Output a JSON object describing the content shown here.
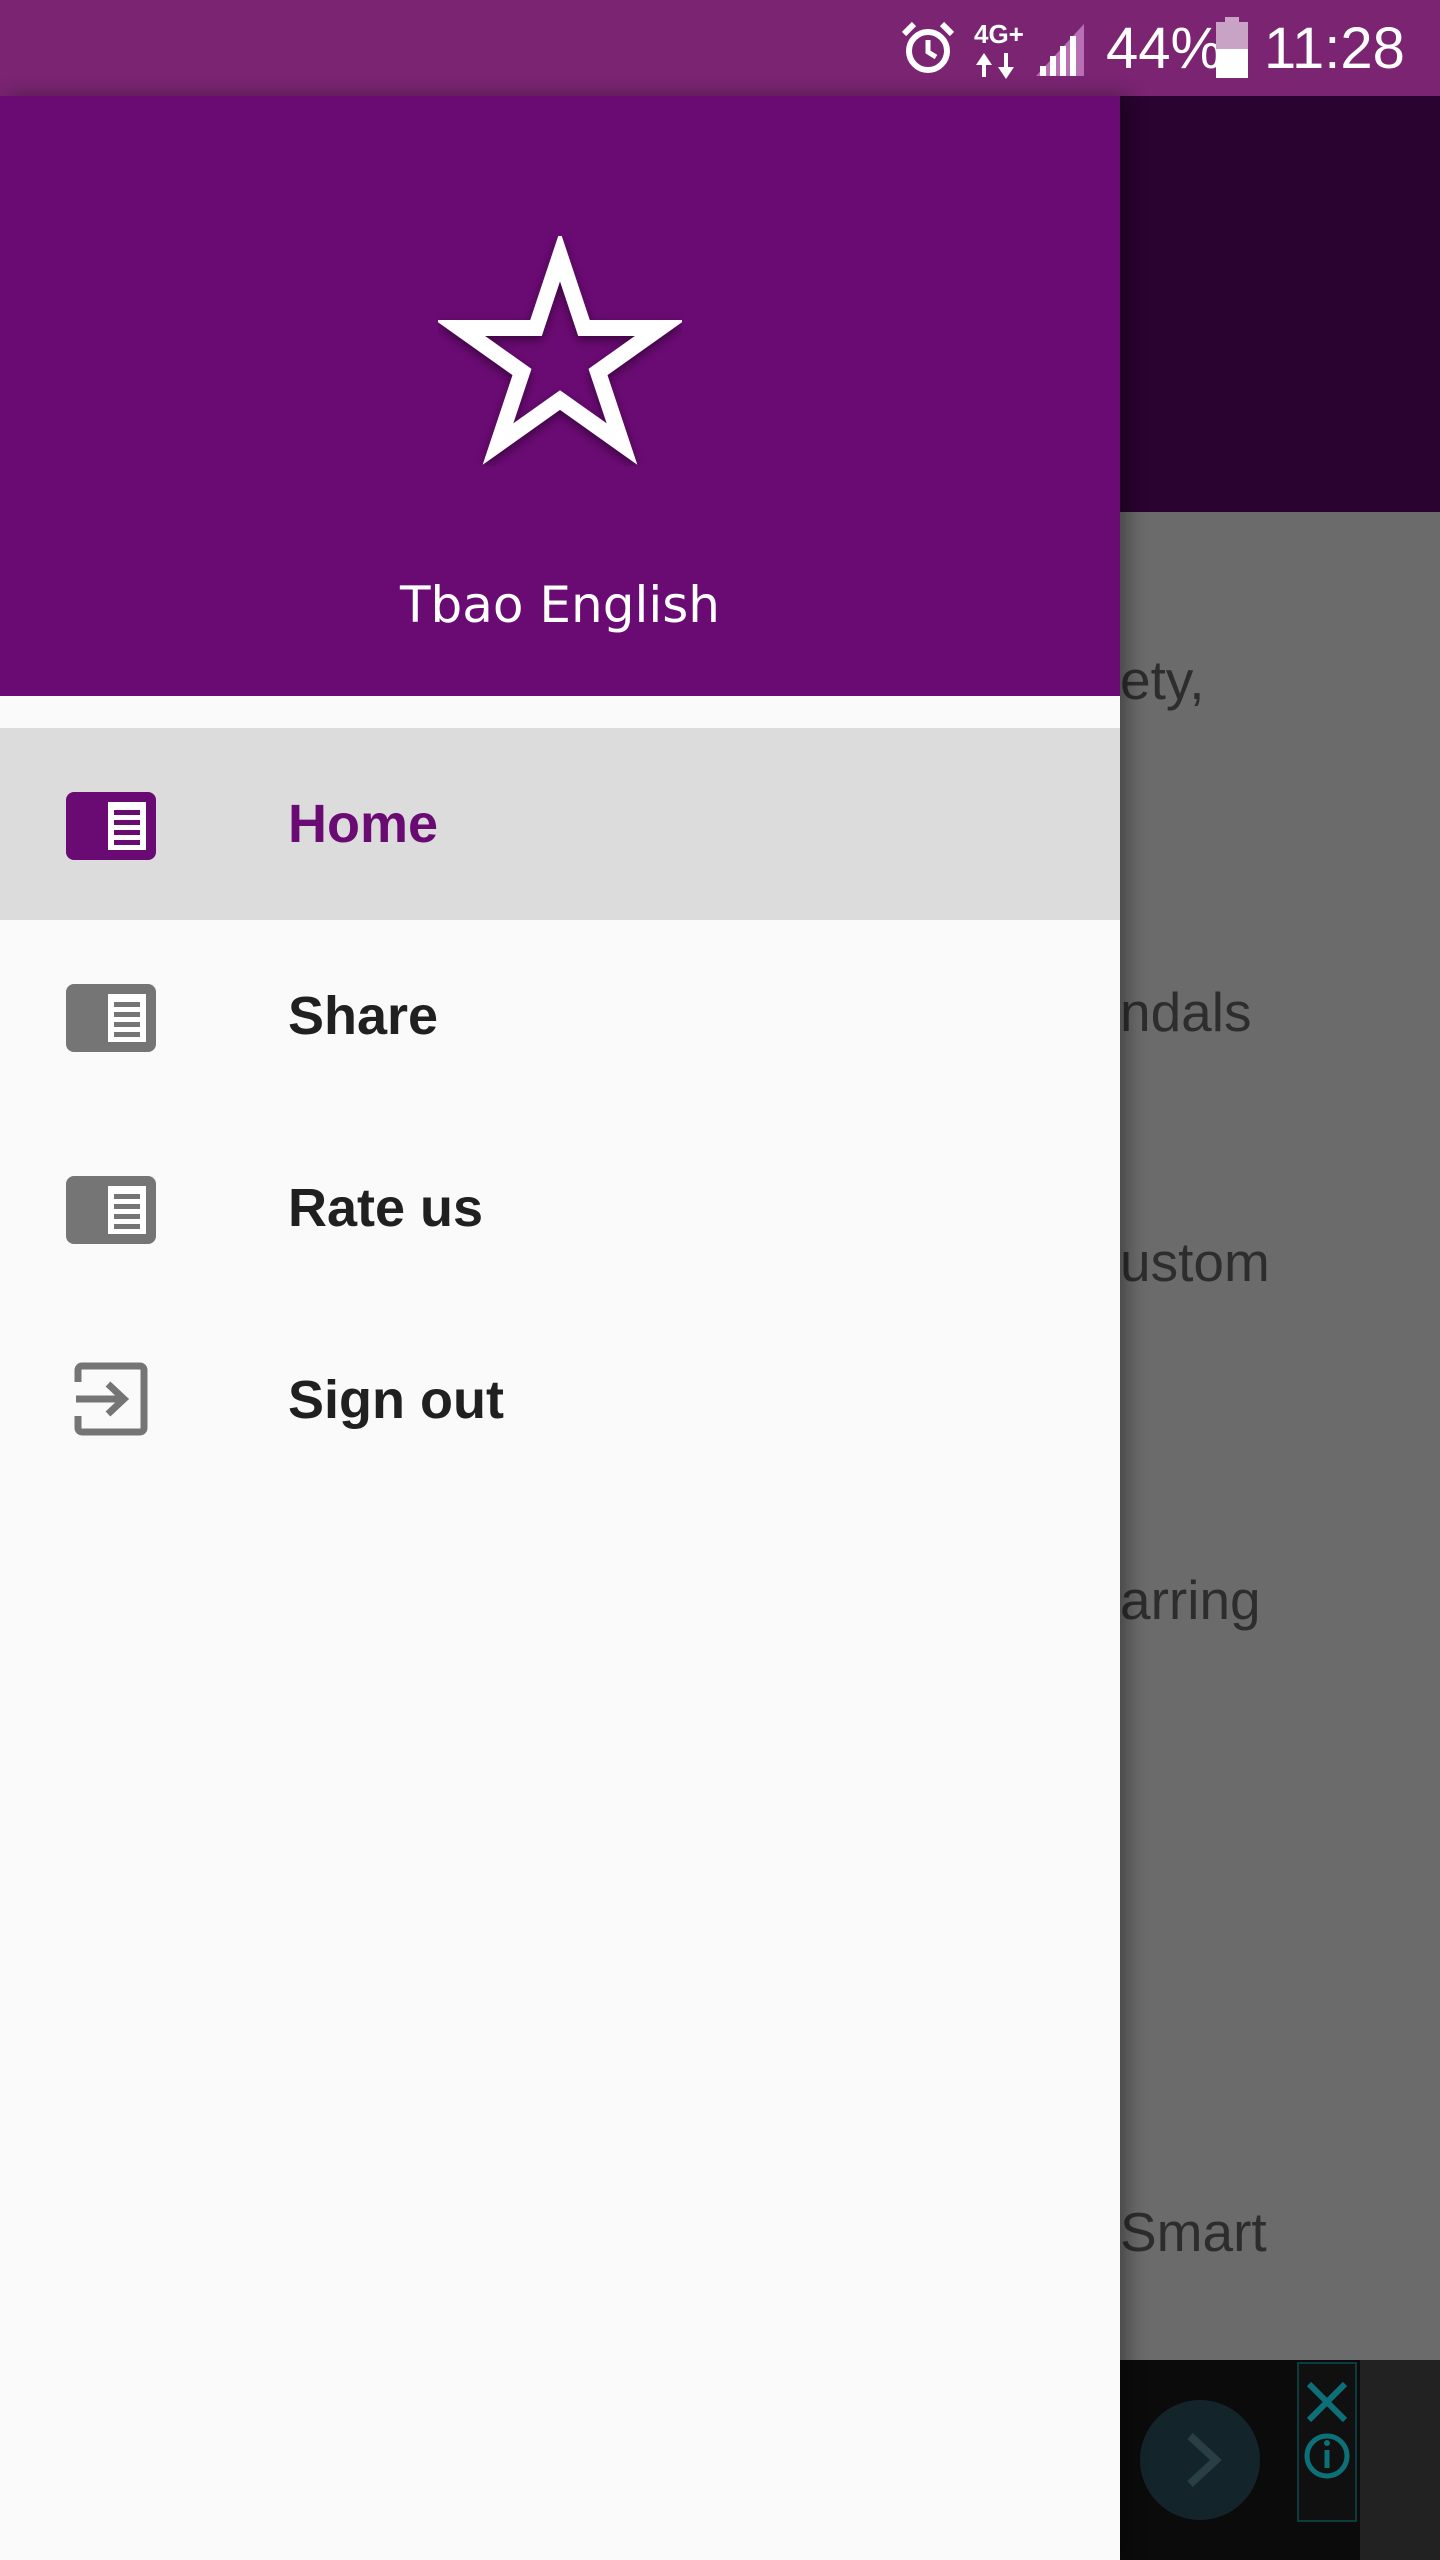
{
  "status_bar": {
    "network_label": "4G+",
    "battery_percent": "44%",
    "time": "11:28",
    "background_color": "#7a2472"
  },
  "drawer": {
    "header": {
      "title": "Tbao English",
      "icon": "star-outline-icon",
      "background_color": "#6a0a73"
    },
    "items": [
      {
        "label": "Home",
        "icon": "article-icon",
        "active": true
      },
      {
        "label": "Share",
        "icon": "article-icon",
        "active": false
      },
      {
        "label": "Rate us",
        "icon": "article-icon",
        "active": false
      },
      {
        "label": "Sign out",
        "icon": "exit-to-app-icon",
        "active": false
      }
    ],
    "accent_color": "#6a0a73"
  },
  "background_content": {
    "fragments": [
      "ety,",
      "ndals",
      "ustom",
      "arring",
      "Smart"
    ]
  }
}
